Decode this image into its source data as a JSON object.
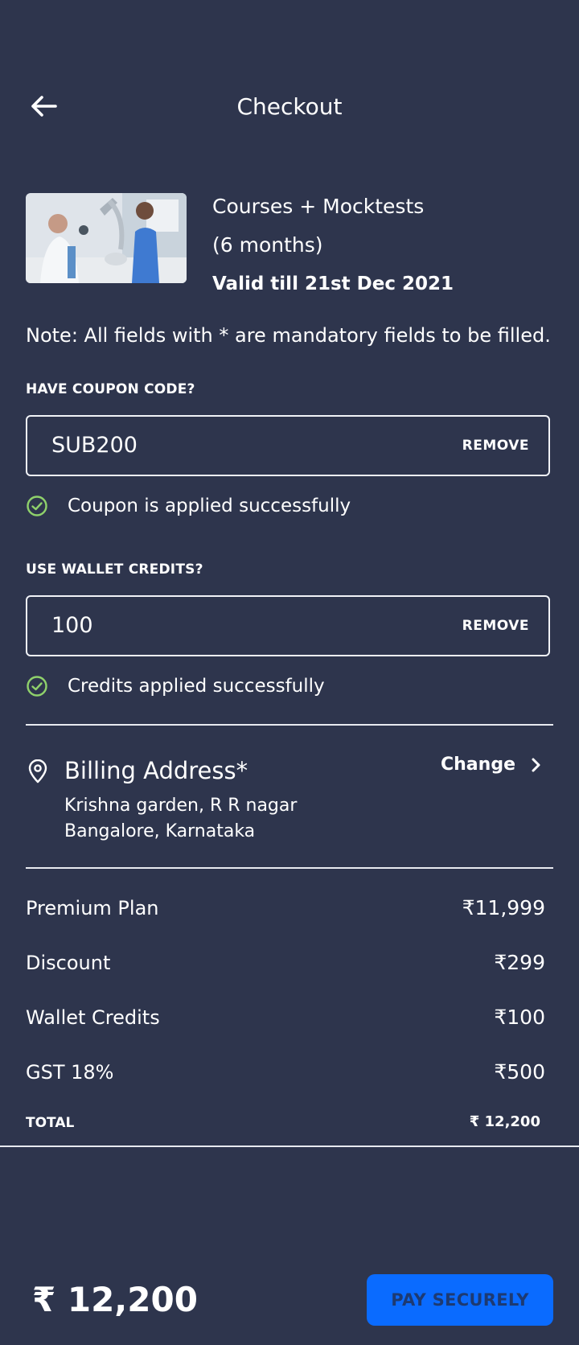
{
  "header": {
    "title": "Checkout",
    "back_icon": "arrow-left-icon"
  },
  "product": {
    "name": "Courses + Mocktests",
    "duration": "(6 months)",
    "validity": "Valid till 21st Dec 2021"
  },
  "note": "Note: All fields with * are mandatory fields to be filled.",
  "coupon": {
    "label": "HAVE COUPON CODE?",
    "value": "SUB200",
    "action": "REMOVE",
    "status": "Coupon is applied successfully"
  },
  "wallet": {
    "label": "USE WALLET CREDITS?",
    "value": "100",
    "action": "REMOVE",
    "status": "Credits applied successfully"
  },
  "billing": {
    "title": "Billing Address*",
    "line1": "Krishna garden, R R nagar",
    "line2": "Bangalore, Karnataka",
    "change_label": "Change"
  },
  "summary": {
    "rows": [
      {
        "label": "Premium Plan",
        "value": "₹11,999"
      },
      {
        "label": "Discount",
        "value": "₹299"
      },
      {
        "label": "Wallet Credits",
        "value": "₹100"
      },
      {
        "label": "GST 18%",
        "value": "₹500"
      }
    ],
    "total_label": "TOTAL",
    "total_value": "₹ 12,200"
  },
  "footer": {
    "amount": "₹ 12,200",
    "pay_label": "PAY SECURELY"
  },
  "colors": {
    "background": "#2e354d",
    "accent": "#0a6bff",
    "success": "#8fd16b"
  }
}
